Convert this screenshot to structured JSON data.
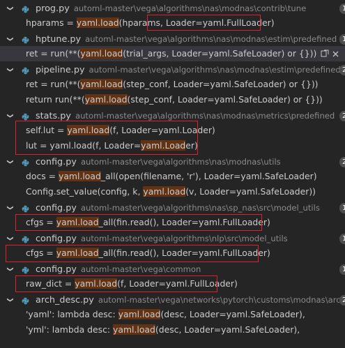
{
  "results": [
    {
      "file": "prog.py",
      "path": "automl-master\\vega\\algorithms\\nas\\modnas\\contrib\\tune",
      "count": "1",
      "matches": [
        {
          "pre": "hparams = ",
          "hit": "yaml.load",
          "post": "(hparams, Loader=yaml.FullLoader)"
        }
      ]
    },
    {
      "file": "hptune.py",
      "path": "automl-master\\vega\\algorithms\\nas\\modnas\\estim\\predefined",
      "count": "1",
      "matches": [
        {
          "pre": "ret = run(**(",
          "hit": "yaml.load",
          "post": "(trial_args, Loader=yaml.SafeLoader) or {}))"
        }
      ]
    },
    {
      "file": "pipeline.py",
      "path": "automl-master\\vega\\algorithms\\nas\\modnas\\estim\\predefined",
      "count": "2",
      "matches": [
        {
          "pre": "ret = run(**(",
          "hit": "yaml.load",
          "post": "(step_conf, Loader=yaml.SafeLoader) or {}))"
        },
        {
          "pre": "return run(**(",
          "hit": "yaml.load",
          "post": "(step_conf, Loader=yaml.SafeLoader) or {}))"
        }
      ]
    },
    {
      "file": "stats.py",
      "path": "automl-master\\vega\\algorithms\\nas\\modnas\\metrics\\predefined",
      "count": "2",
      "matches": [
        {
          "pre": "self.lut = ",
          "hit": "yaml.load",
          "post": "(f, Loader=yaml.Loader)"
        },
        {
          "pre": "lut = yaml.load(f, Loader=",
          "hit": "yaml.Load",
          "post": "er)"
        }
      ]
    },
    {
      "file": "config.py",
      "path": "automl-master\\vega\\algorithms\\nas\\modnas\\utils",
      "count": "2",
      "matches": [
        {
          "pre": "docs = ",
          "hit": "yaml.load",
          "post": "_all(open(filename, 'r'), Loader=yaml.SafeLoader)"
        },
        {
          "pre": "Config.set_value(config, k, ",
          "hit": "yaml.load",
          "post": "(v, Loader=yaml.SafeLoader))"
        }
      ]
    },
    {
      "file": "config.py",
      "path": "automl-master\\vega\\algorithms\\nas\\sp_nas\\src\\model_utils",
      "count": "1",
      "matches": [
        {
          "pre": "cfgs = ",
          "hit": "yaml.load",
          "post": "_all(fin.read(), Loader=yaml.FullLoader)"
        }
      ]
    },
    {
      "file": "config.py",
      "path": "automl-master\\vega\\algorithms\\nlp\\src\\model_utils",
      "count": "1",
      "matches": [
        {
          "pre": "cfgs = ",
          "hit": "yaml.load",
          "post": "_all(fin.read(), Loader=yaml.FullLoader)"
        }
      ]
    },
    {
      "file": "config.py",
      "path": "automl-master\\vega\\common",
      "count": "1",
      "matches": [
        {
          "pre": "raw_dict = ",
          "hit": "yaml.load",
          "post": "(f, Loader=yaml.FullLoader)"
        }
      ]
    },
    {
      "file": "arch_desc.py",
      "path": "automl-master\\vega\\networks\\pytorch\\customs\\modnas\\arch_spa...",
      "count": "2",
      "matches": [
        {
          "pre": "'yaml': lambda desc: ",
          "hit": "yaml.load",
          "post": "(desc, Loader=yaml.SafeLoader),"
        },
        {
          "pre": "'yml': lambda desc: ",
          "hit": "yaml.load",
          "post": "(desc, Loader=yaml.SafeLoader),"
        }
      ]
    }
  ],
  "colors": {
    "background": "#252526",
    "match_highlight": "#613214",
    "annotation_red": "#e0202a",
    "python_icon": "#519aba"
  }
}
